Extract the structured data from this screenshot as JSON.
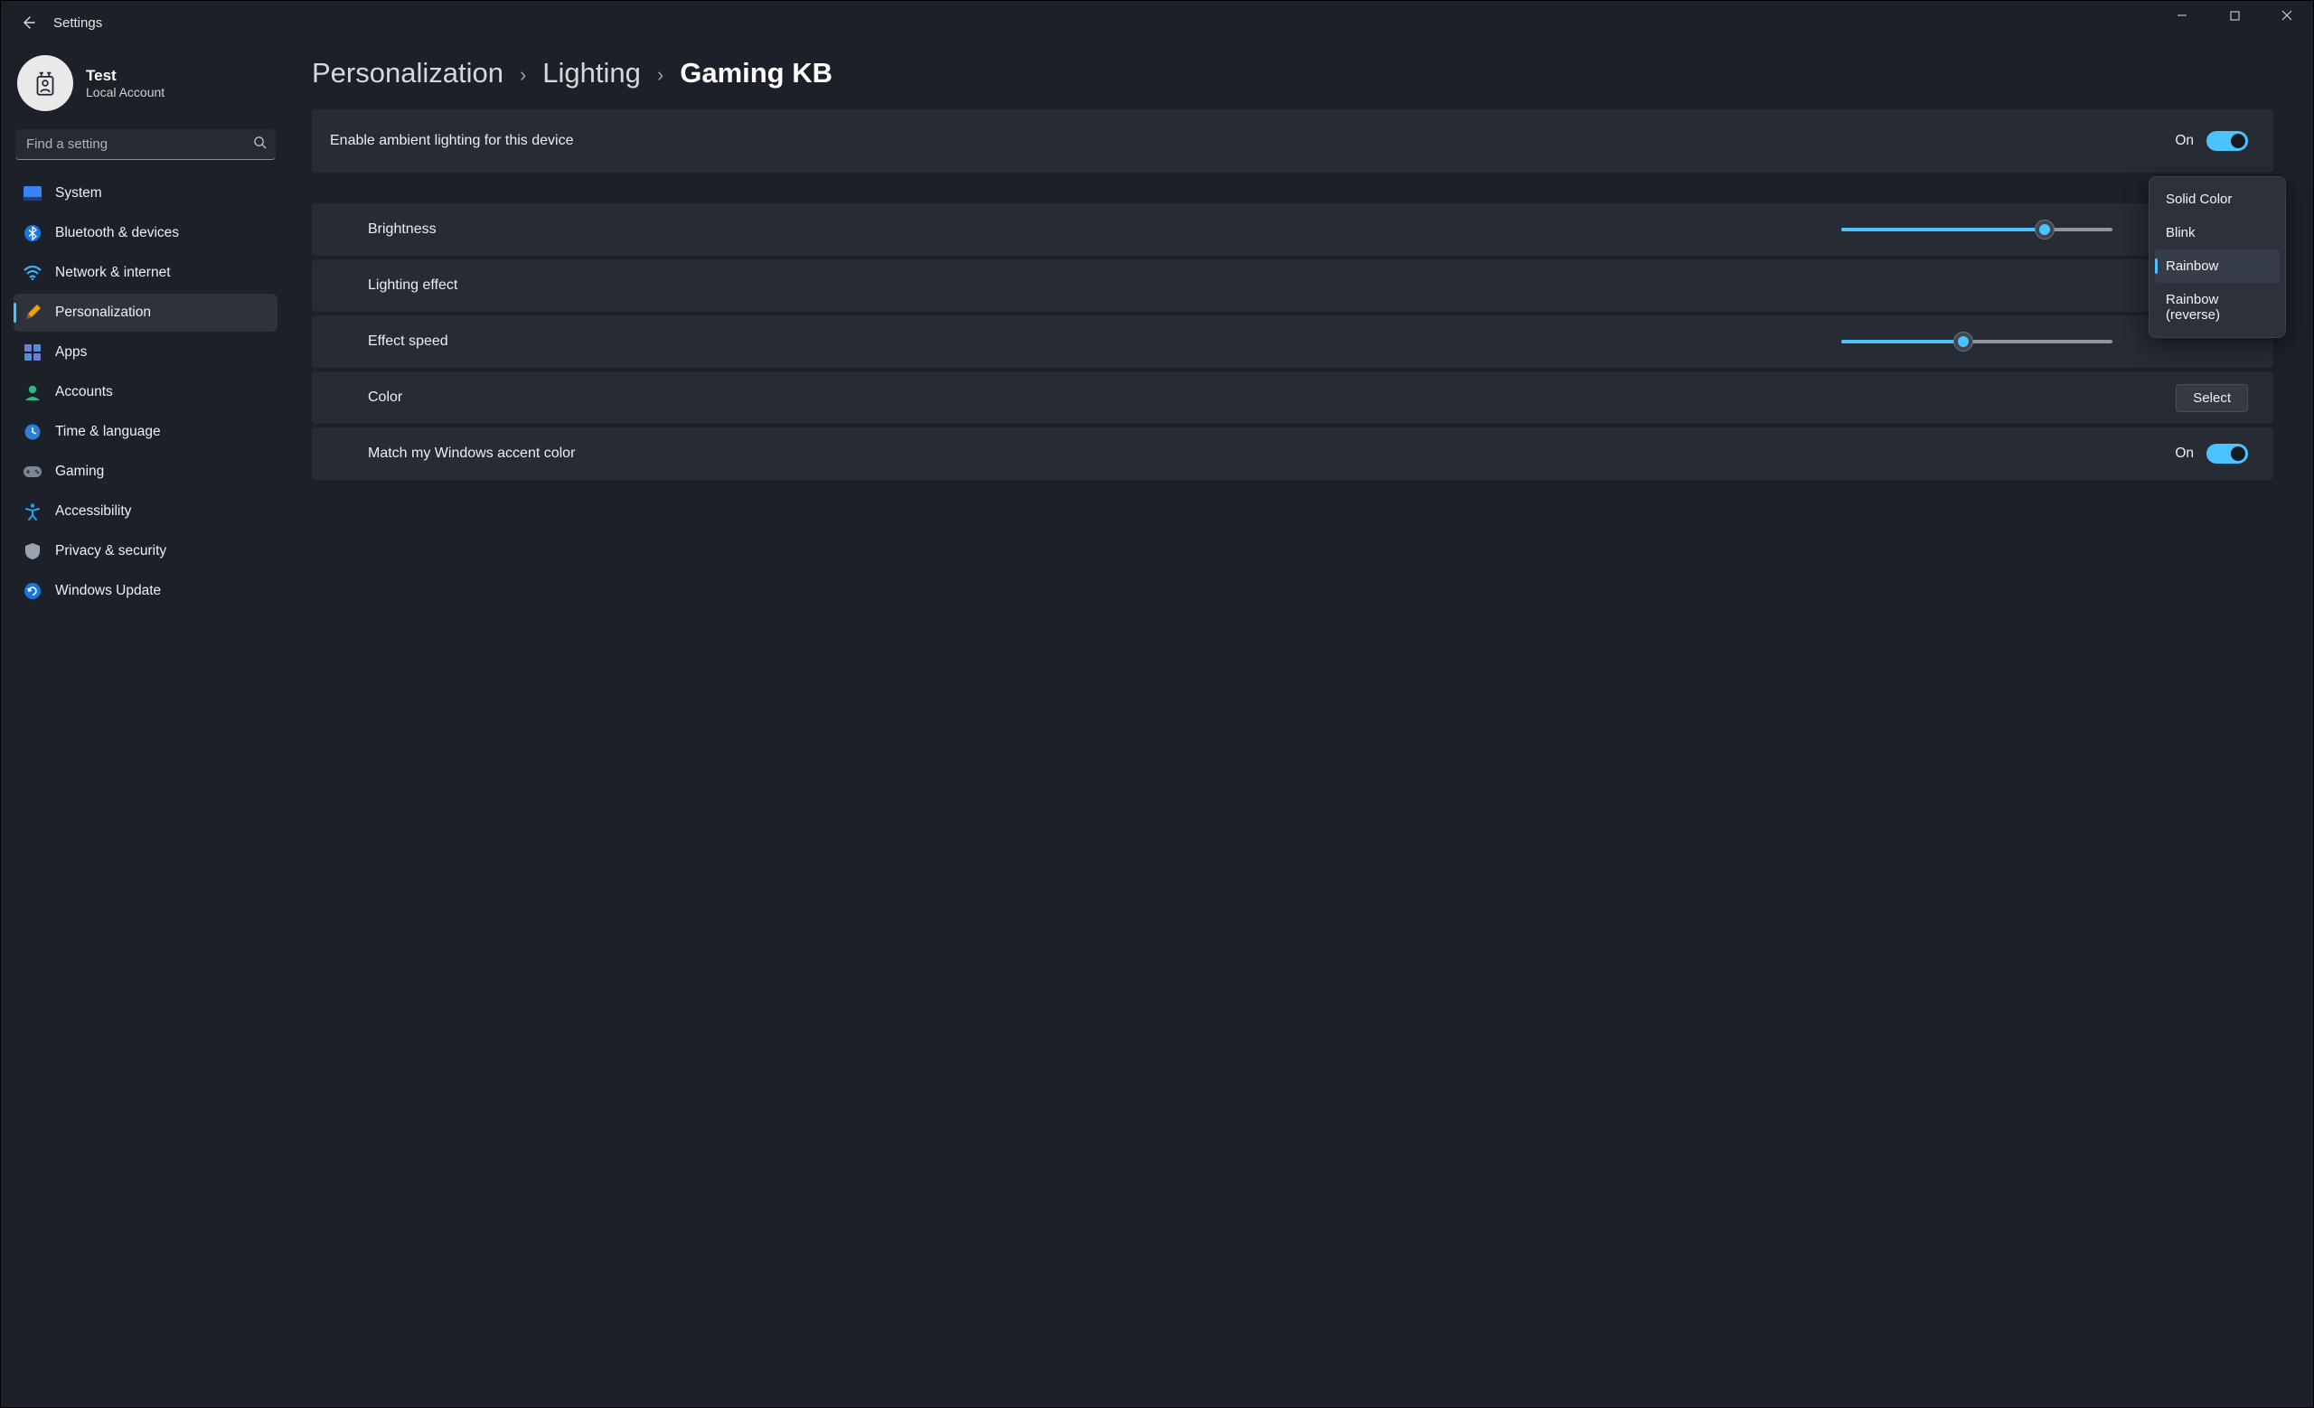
{
  "window": {
    "title": "Settings"
  },
  "user": {
    "name": "Test",
    "role": "Local Account"
  },
  "search": {
    "placeholder": "Find a setting"
  },
  "nav": {
    "items": [
      {
        "id": "system",
        "label": "System"
      },
      {
        "id": "bluetooth",
        "label": "Bluetooth & devices"
      },
      {
        "id": "network",
        "label": "Network & internet"
      },
      {
        "id": "personalization",
        "label": "Personalization"
      },
      {
        "id": "apps",
        "label": "Apps"
      },
      {
        "id": "accounts",
        "label": "Accounts"
      },
      {
        "id": "time",
        "label": "Time & language"
      },
      {
        "id": "gaming",
        "label": "Gaming"
      },
      {
        "id": "accessibility",
        "label": "Accessibility"
      },
      {
        "id": "privacy",
        "label": "Privacy & security"
      },
      {
        "id": "update",
        "label": "Windows Update"
      }
    ],
    "active_id": "personalization"
  },
  "breadcrumb": {
    "items": [
      "Personalization",
      "Lighting",
      "Gaming KB"
    ]
  },
  "settings": {
    "enable_ambient": {
      "label": "Enable ambient lighting for this device",
      "state_label": "On",
      "on": true
    },
    "brightness": {
      "label": "Brightness",
      "value": 75,
      "min": 0,
      "max": 100
    },
    "lighting_effect": {
      "label": "Lighting effect",
      "selected": "Rainbow",
      "options": [
        "Solid Color",
        "Blink",
        "Rainbow",
        "Rainbow (reverse)"
      ]
    },
    "effect_speed": {
      "label": "Effect speed",
      "value": 45,
      "min": 0,
      "max": 100
    },
    "color": {
      "label": "Color",
      "button": "Select"
    },
    "match_accent": {
      "label": "Match my Windows accent color",
      "state_label": "On",
      "on": true
    }
  },
  "colors": {
    "accent": "#4cc2ff"
  }
}
